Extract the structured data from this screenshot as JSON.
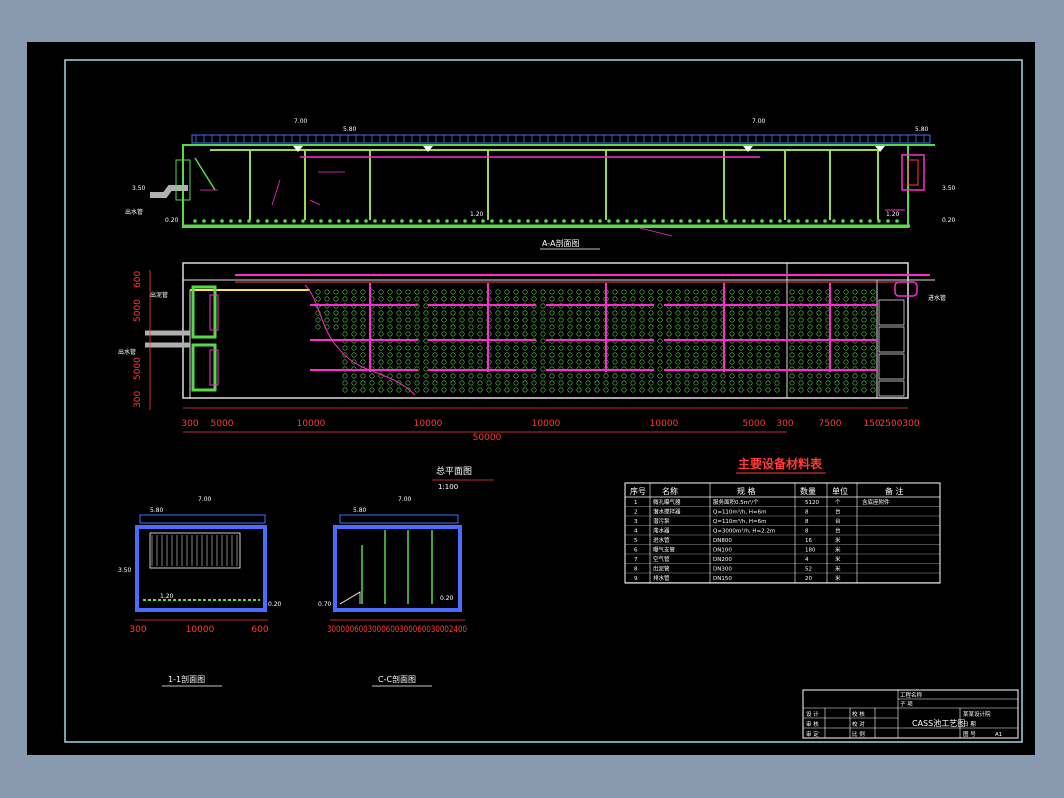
{
  "drawing": {
    "colors": {
      "background": "#8a9aae",
      "sheet": "#000000",
      "border": "#9ad7e8",
      "frame": "#cfcfcf",
      "green": "#59d84a",
      "magenta": "#ff2bd0",
      "red": "#ff3a3a",
      "blue": "#4a6cff",
      "cyan": "#38d8ff",
      "yellow": "#ffe14a",
      "white": "#ffffff"
    },
    "section_aa": {
      "title": "A-A剖面图",
      "elev_top_left": "7.00",
      "elev_top_right": "7.00",
      "elev_walkway": "5.80",
      "elev_right_top": "5.80",
      "elev_left_inlet": "3.50",
      "elev_left_bottom": "0.20",
      "elev_right_mid": "3.50",
      "elev_right_bottom": "0.20",
      "elev_inner": "1.20",
      "elev_inner2": "1.20",
      "pipe_label": "出水管"
    },
    "plan": {
      "title": "总平面图",
      "scale": "1:100",
      "left_label_top": "出泥管",
      "left_label_mid": "出水管",
      "right_label": "进水管",
      "left_dims": [
        "600",
        "5000",
        "5000",
        "300"
      ],
      "bottom_dims": [
        "300",
        "5000",
        "10000",
        "10000",
        "10000",
        "10000",
        "5000",
        "300",
        "7500",
        "150",
        "2500",
        "300"
      ],
      "total_dim": "50000"
    },
    "section_11": {
      "title": "1-1剖面图",
      "elev_top": "7.00",
      "elev_walk": "5.80",
      "elev_left": "3.50",
      "elev_bottom": "0.20",
      "elev_inner": "1.20",
      "dims": [
        "300",
        "10000",
        "600"
      ]
    },
    "section_cc": {
      "title": "C-C剖面图",
      "elev_top": "7.00",
      "elev_walk": "5.80",
      "elev_left": "0.70",
      "elev_bottom": "0.20",
      "dims": "3000006003000600300060030002400"
    },
    "material_table": {
      "title": "主要设备材料表",
      "headers": [
        "序号",
        "名称",
        "规 格",
        "数量",
        "单位",
        "备 注"
      ],
      "rows": [
        [
          "1",
          "微孔曝气器",
          "服务面积0.5m²/个",
          "5120",
          "个",
          "含底座附件"
        ],
        [
          "2",
          "潜水搅拌器",
          "Q=110m³/h, H=6m",
          "8",
          "台",
          ""
        ],
        [
          "3",
          "潜污泵",
          "Q=110m³/h, H=6m",
          "8",
          "台",
          ""
        ],
        [
          "4",
          "滗水器",
          "Q=3000m³/h, H=2.2m",
          "8",
          "台",
          ""
        ],
        [
          "5",
          "进水管",
          "DN800",
          "16",
          "米",
          ""
        ],
        [
          "6",
          "曝气支管",
          "DN100",
          "180",
          "米",
          ""
        ],
        [
          "7",
          "空气管",
          "DN200",
          "4",
          "米",
          ""
        ],
        [
          "8",
          "出泥管",
          "DN300",
          "52",
          "米",
          ""
        ],
        [
          "9",
          "排水管",
          "DN150",
          "20",
          "米",
          ""
        ]
      ]
    },
    "title_block": {
      "r1": "工程名称",
      "r1b": "子 项",
      "r2a": "设 计",
      "r2b": "校 核",
      "r2c": "某某设计院",
      "r3a": "审 核",
      "r3b": "校 对",
      "r3c": "CASS池工艺图",
      "r3d": "日 期",
      "r4a": "审 定",
      "r4b": "比 例",
      "r4c": "图 号",
      "r4d": "A1"
    }
  }
}
